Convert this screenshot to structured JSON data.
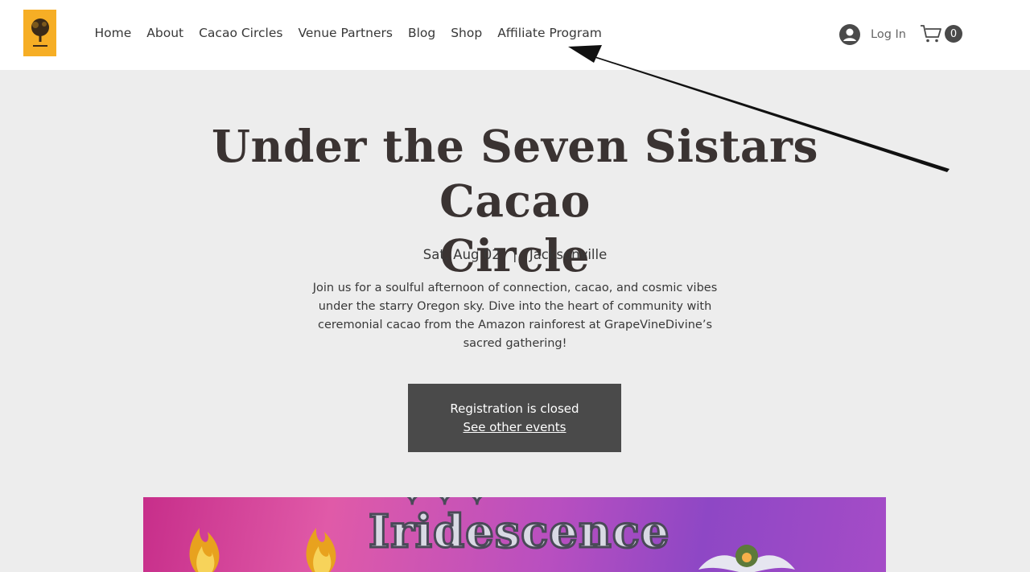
{
  "header": {
    "nav": [
      "Home",
      "About",
      "Cacao Circles",
      "Venue Partners",
      "Blog",
      "Shop",
      "Affiliate Program"
    ],
    "login_label": "Log In",
    "cart_count": "0"
  },
  "event": {
    "title_line1": "Under the Seven Sistars Cacao",
    "title_line2": "Circle",
    "date": "Sat, Aug 02",
    "separator": "|",
    "location": "Jacksonville",
    "description": "Join us for a soulful afternoon of connection, cacao, and cosmic vibes under the starry Oregon sky. Dive into the heart of community with ceremonial cacao from the Amazon rainforest at GrapeVineDivine’s sacred gathering!",
    "registration_status": "Registration is closed",
    "other_events_link": "See other events"
  },
  "banner": {
    "title": "Iridescence"
  },
  "colors": {
    "logo_bg": "#f6ae25",
    "page_bg": "#ededed",
    "button_bg": "#4a4a4a"
  }
}
